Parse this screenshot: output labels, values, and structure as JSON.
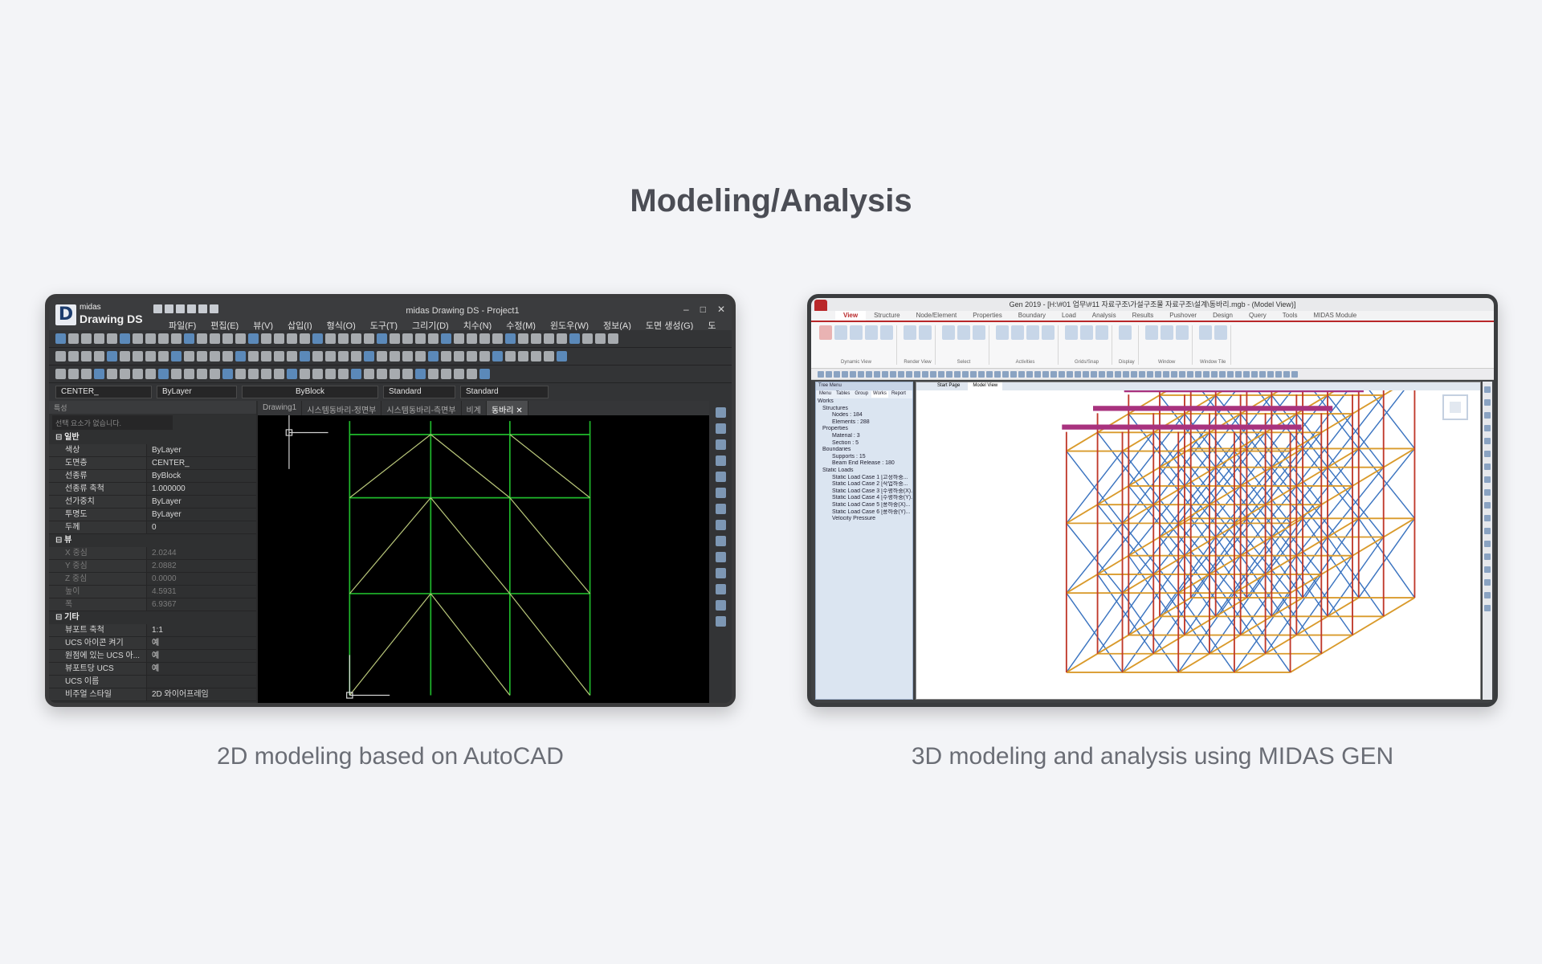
{
  "page": {
    "title": "Modeling/Analysis"
  },
  "cards": {
    "left": {
      "caption": "2D modeling based on AutoCAD",
      "app": {
        "brand_small": "midas",
        "brand_name": "Drawing DS",
        "window_title": "midas Drawing DS - Project1",
        "menu": [
          "파일(F)",
          "편집(E)",
          "뷰(V)",
          "삽입(I)",
          "형식(O)",
          "도구(T)",
          "그리기(D)",
          "치수(N)",
          "수정(M)",
          "윈도우(W)",
          "정보(A)",
          "도면 생성(G)",
          "도"
        ],
        "prop_bar": {
          "layer": "CENTER_",
          "color": "ByLayer",
          "linetype": "ByBlock",
          "text_style": "Standard",
          "dim_style": "Standard"
        },
        "panel": {
          "header": "특성",
          "selection": "선택 요소가 없습니다.",
          "sections": [
            {
              "label": "일반",
              "rows": [
                {
                  "key": "색상",
                  "value": "ByLayer"
                },
                {
                  "key": "도면층",
                  "value": "CENTER_"
                },
                {
                  "key": "선종류",
                  "value": "ByBlock"
                },
                {
                  "key": "선종류 축척",
                  "value": "1.000000"
                },
                {
                  "key": "선가중치",
                  "value": "ByLayer"
                },
                {
                  "key": "투명도",
                  "value": "ByLayer"
                },
                {
                  "key": "두께",
                  "value": "0"
                }
              ]
            },
            {
              "label": "뷰",
              "rows": [
                {
                  "key": "X 중심",
                  "value": "2.0244"
                },
                {
                  "key": "Y 중심",
                  "value": "2.0882"
                },
                {
                  "key": "Z 중심",
                  "value": "0.0000"
                },
                {
                  "key": "높이",
                  "value": "4.5931"
                },
                {
                  "key": "폭",
                  "value": "6.9367"
                }
              ]
            },
            {
              "label": "기타",
              "rows": [
                {
                  "key": "뷰포트 축척",
                  "value": "1:1"
                },
                {
                  "key": "UCS 아이콘 켜기",
                  "value": "예"
                },
                {
                  "key": "원점에 있는 UCS 아...",
                  "value": "예"
                },
                {
                  "key": "뷰포트당 UCS",
                  "value": "예"
                },
                {
                  "key": "UCS 이름",
                  "value": ""
                },
                {
                  "key": "비주얼 스타일",
                  "value": "2D 와이어프레임"
                }
              ]
            }
          ]
        },
        "doc_tabs": [
          "Drawing1",
          "시스템동바리-정면부",
          "시스템동바리-측면부",
          "비계",
          "동바리"
        ],
        "active_doc_tab": 4,
        "colors": {
          "frame_lines": "#1fb82b",
          "brace_lines": "#b9c77a",
          "canvas": "#000000"
        }
      }
    },
    "right": {
      "caption": "3D modeling and analysis using MIDAS GEN",
      "app": {
        "window_title": "Gen 2019 - [H:\\#01 업무\\#11 자료구조\\가설구조물 자료구조\\설계\\동바리.mgb - (Model View)]",
        "ribbon_tabs": [
          "View",
          "Structure",
          "Node/Element",
          "Properties",
          "Boundary",
          "Load",
          "Analysis",
          "Results",
          "Pushover",
          "Design",
          "Query",
          "Tools",
          "MIDAS Module"
        ],
        "active_ribbon_tab": 0,
        "ribbon_groups": [
          "Dynamic View",
          "Render View",
          "Select",
          "Activities",
          "Grids/Snap",
          "Display",
          "Window",
          "Window Tile"
        ],
        "tree": {
          "header": "Tree Menu",
          "tabs": [
            "Menu",
            "Tables",
            "Group",
            "Works",
            "Report"
          ],
          "active_tab": 3,
          "lines": [
            "Works",
            "Structures",
            "Nodes : 184",
            "Elements : 288",
            "Properties",
            "Material : 3",
            "Section : 5",
            "Boundaries",
            "Supports : 15",
            "Beam End Release : 180",
            "Static Loads",
            "Static Load Case 1 [고정하중...",
            "Static Load Case 2 [작업하중...",
            "Static Load Case 3 [수평하중(X)...",
            "Static Load Case 4 [수평하중(Y)...",
            "Static Load Case 5 [풍하중(X)...",
            "Static Load Case 6 [풍하중(Y)...",
            "Velocity Pressure"
          ]
        },
        "view_tabs": [
          "Start Page",
          "Model View"
        ],
        "active_view_tab": 1,
        "colors": {
          "columns": "#c0392b",
          "ledgers": "#d99a2b",
          "braces": "#3b74c0",
          "top_beams": "#a8327e"
        }
      }
    }
  }
}
